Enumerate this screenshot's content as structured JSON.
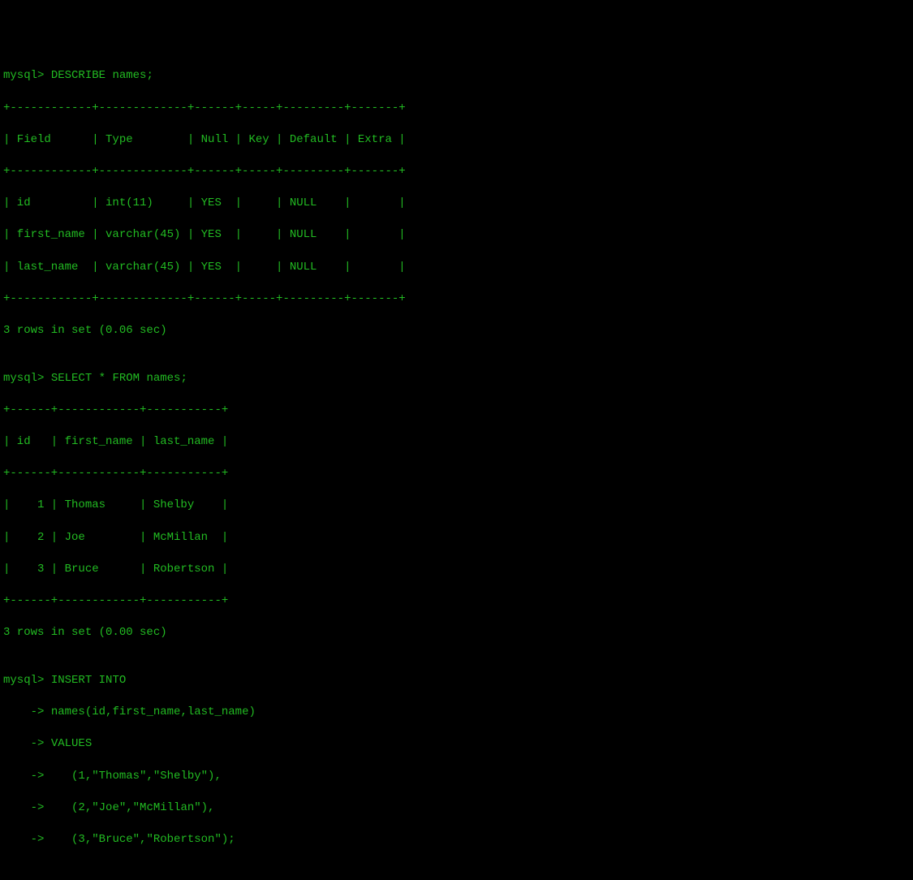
{
  "prompt": "mysql>",
  "continuation_prompt": "    ->",
  "commands": {
    "describe": "DESCRIBE names;",
    "select": "SELECT * FROM names;",
    "insert_line1": "INSERT INTO",
    "insert_line2": "names(id,first_name,last_name)",
    "insert_line3": "VALUES",
    "insert_line4": "   (1,\"Thomas\",\"Shelby\"),",
    "insert_line5": "   (2,\"Joe\",\"McMillan\"),",
    "insert_line6": "   (3,\"Bruce\",\"Robertson\");"
  },
  "describe_table": {
    "border_top": "+------------+-------------+------+-----+---------+-------+",
    "header": "| Field      | Type        | Null | Key | Default | Extra |",
    "border_mid": "+------------+-------------+------+-----+---------+-------+",
    "row1": "| id         | int(11)     | YES  |     | NULL    |       |",
    "row2": "| first_name | varchar(45) | YES  |     | NULL    |       |",
    "row3": "| last_name  | varchar(45) | YES  |     | NULL    |       |",
    "border_bottom": "+------------+-------------+------+-----+---------+-------+",
    "summary": "3 rows in set (0.06 sec)"
  },
  "select_table": {
    "border_top": "+------+------------+-----------+",
    "header": "| id   | first_name | last_name |",
    "border_mid": "+------+------------+-----------+",
    "row1": "|    1 | Thomas     | Shelby    |",
    "row2": "|    2 | Joe        | McMillan  |",
    "row3": "|    3 | Bruce      | Robertson |",
    "border_bottom": "+------+------------+-----------+",
    "summary": "3 rows in set (0.00 sec)"
  },
  "blank": ""
}
